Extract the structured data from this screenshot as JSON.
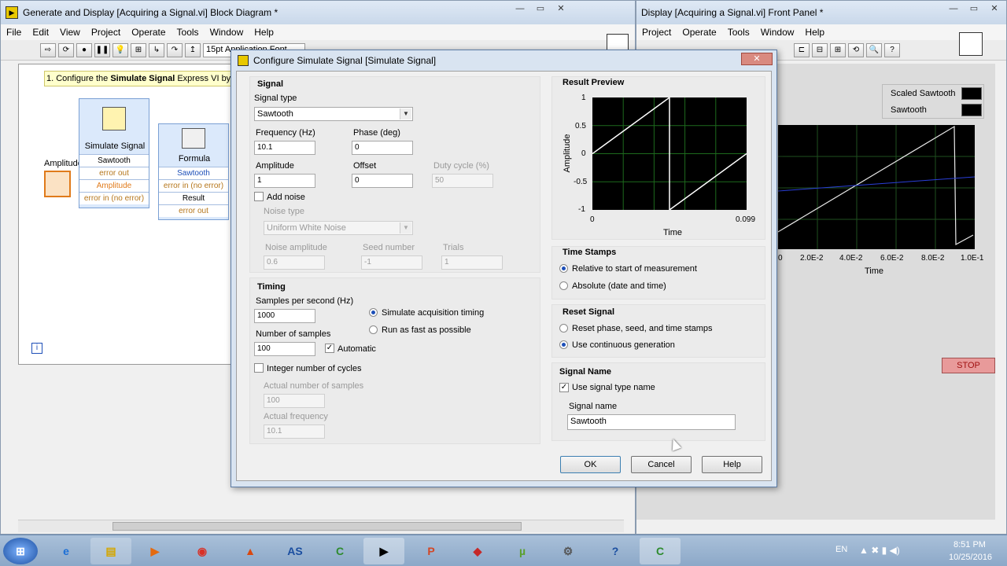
{
  "block_diagram": {
    "title": "Generate and Display [Acquiring a Signal.vi] Block Diagram *",
    "menu": [
      "File",
      "Edit",
      "View",
      "Project",
      "Operate",
      "Tools",
      "Window",
      "Help"
    ],
    "font_box": "15pt Application Font",
    "instruction_prefix": "1. Configure the ",
    "instruction_bold": "Simulate Signal",
    "instruction_suffix": " Express VI by d",
    "simulate_node": {
      "title": "Simulate Signal",
      "rows": [
        "Sawtooth",
        "error out",
        "Amplitude",
        "error in (no error)"
      ]
    },
    "formula_node": {
      "title": "Formula",
      "rows": [
        "Sawtooth",
        "error in (no error)",
        "Result",
        "error out"
      ]
    },
    "amplitude_label": "Amplitude"
  },
  "front_panel": {
    "title": "Display [Acquiring a Signal.vi] Front Panel *",
    "menu": [
      "Project",
      "Operate",
      "Tools",
      "Window",
      "Help"
    ],
    "legend": [
      "Scaled Sawtooth",
      "Sawtooth"
    ],
    "x_ticks": [
      "0",
      "2.0E-2",
      "4.0E-2",
      "6.0E-2",
      "8.0E-2",
      "1.0E-1"
    ],
    "x_label": "Time",
    "stop_label": "STOP"
  },
  "dialog": {
    "title": "Configure Simulate Signal [Simulate Signal]",
    "signal": {
      "header": "Signal",
      "signal_type_label": "Signal type",
      "signal_type_value": "Sawtooth",
      "frequency_label": "Frequency (Hz)",
      "frequency_value": "10.1",
      "phase_label": "Phase (deg)",
      "phase_value": "0",
      "amplitude_label": "Amplitude",
      "amplitude_value": "1",
      "offset_label": "Offset",
      "offset_value": "0",
      "duty_label": "Duty cycle (%)",
      "duty_value": "50",
      "add_noise_label": "Add noise",
      "add_noise_checked": false,
      "noise_type_label": "Noise type",
      "noise_type_value": "Uniform White Noise",
      "noise_amp_label": "Noise amplitude",
      "noise_amp_value": "0.6",
      "seed_label": "Seed number",
      "seed_value": "-1",
      "trials_label": "Trials",
      "trials_value": "1"
    },
    "timing": {
      "header": "Timing",
      "sps_label": "Samples per second (Hz)",
      "sps_value": "1000",
      "simulate_label": "Simulate acquisition timing",
      "fast_label": "Run as fast as possible",
      "nsamples_label": "Number of samples",
      "nsamples_value": "100",
      "automatic_label": "Automatic",
      "automatic_checked": true,
      "integer_label": "Integer number of cycles",
      "integer_checked": false,
      "actual_samples_label": "Actual number of samples",
      "actual_samples_value": "100",
      "actual_freq_label": "Actual frequency",
      "actual_freq_value": "10.1"
    },
    "preview": {
      "header": "Result Preview",
      "y_label": "Amplitude",
      "x_label": "Time",
      "y_ticks": [
        "1",
        "0.5",
        "0",
        "-0.5",
        "-1"
      ],
      "x_ticks": [
        "0",
        "0.099"
      ]
    },
    "timestamps": {
      "header": "Time Stamps",
      "opt1": "Relative to start of measurement",
      "opt2": "Absolute (date and time)"
    },
    "reset": {
      "header": "Reset Signal",
      "opt1": "Reset phase, seed, and time stamps",
      "opt2": "Use continuous generation"
    },
    "signal_name": {
      "header": "Signal Name",
      "use_type_label": "Use signal type name",
      "use_type_checked": true,
      "name_label": "Signal name",
      "name_value": "Sawtooth"
    },
    "buttons": {
      "ok": "OK",
      "cancel": "Cancel",
      "help": "Help"
    }
  },
  "taskbar": {
    "lang": "EN",
    "time": "8:51 PM",
    "date": "10/25/2016",
    "apps": [
      "start",
      "ie",
      "explorer",
      "media",
      "chrome",
      "matlab",
      "as",
      "camtasia",
      "labview",
      "powerpoint",
      "3d",
      "utorrent",
      "tool",
      "help",
      "camtasia2"
    ]
  },
  "chart_data": {
    "type": "line",
    "title": "Result Preview",
    "xlabel": "Time",
    "ylabel": "Amplitude",
    "xlim": [
      0,
      0.099
    ],
    "ylim": [
      -1,
      1
    ],
    "series": [
      {
        "name": "",
        "x": [
          0,
          0.0495,
          0.0495,
          0.099
        ],
        "values": [
          0.0,
          1.0,
          -1.0,
          0.0
        ]
      }
    ]
  },
  "colors": {
    "accent": "#1d4fb8",
    "stop_button": "#c04040",
    "plot_bg": "#000000",
    "plot_grid": "#1d6a1d"
  }
}
